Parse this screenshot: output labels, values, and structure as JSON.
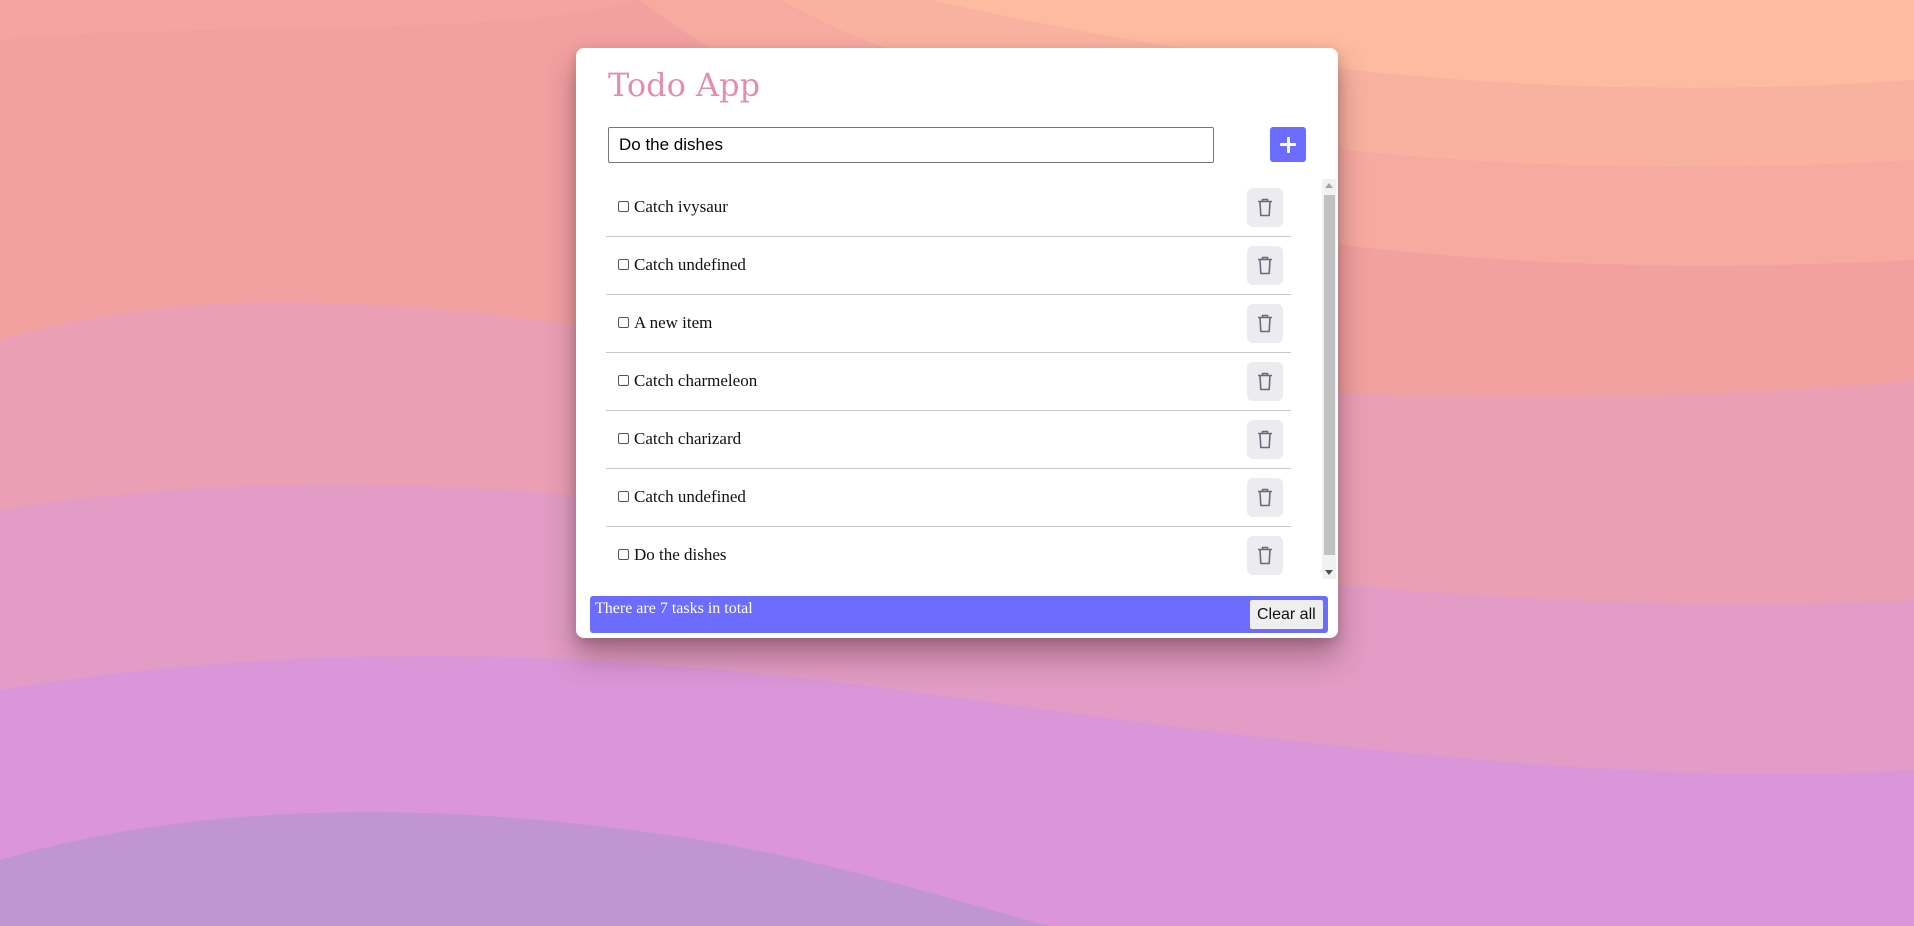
{
  "app": {
    "title": "Todo App"
  },
  "input": {
    "value": "Do the dishes",
    "add_icon": "plus-icon"
  },
  "tasks": [
    {
      "label": "Catch ivysaur",
      "checked": false
    },
    {
      "label": "Catch undefined",
      "checked": false
    },
    {
      "label": "A new item",
      "checked": false
    },
    {
      "label": "Catch charmeleon",
      "checked": false
    },
    {
      "label": "Catch charizard",
      "checked": false
    },
    {
      "label": "Catch undefined",
      "checked": false
    },
    {
      "label": "Do the dishes",
      "checked": false
    }
  ],
  "delete_icon": "trash-icon",
  "footer": {
    "summary": "There are 7 tasks in total",
    "clear_label": "Clear all"
  },
  "colors": {
    "accent": "#6c6cff",
    "title": "#e08fb0",
    "delete_bg": "#ebebf0",
    "background_top": "#ffbfa0",
    "background_bottom": "#d996de"
  }
}
